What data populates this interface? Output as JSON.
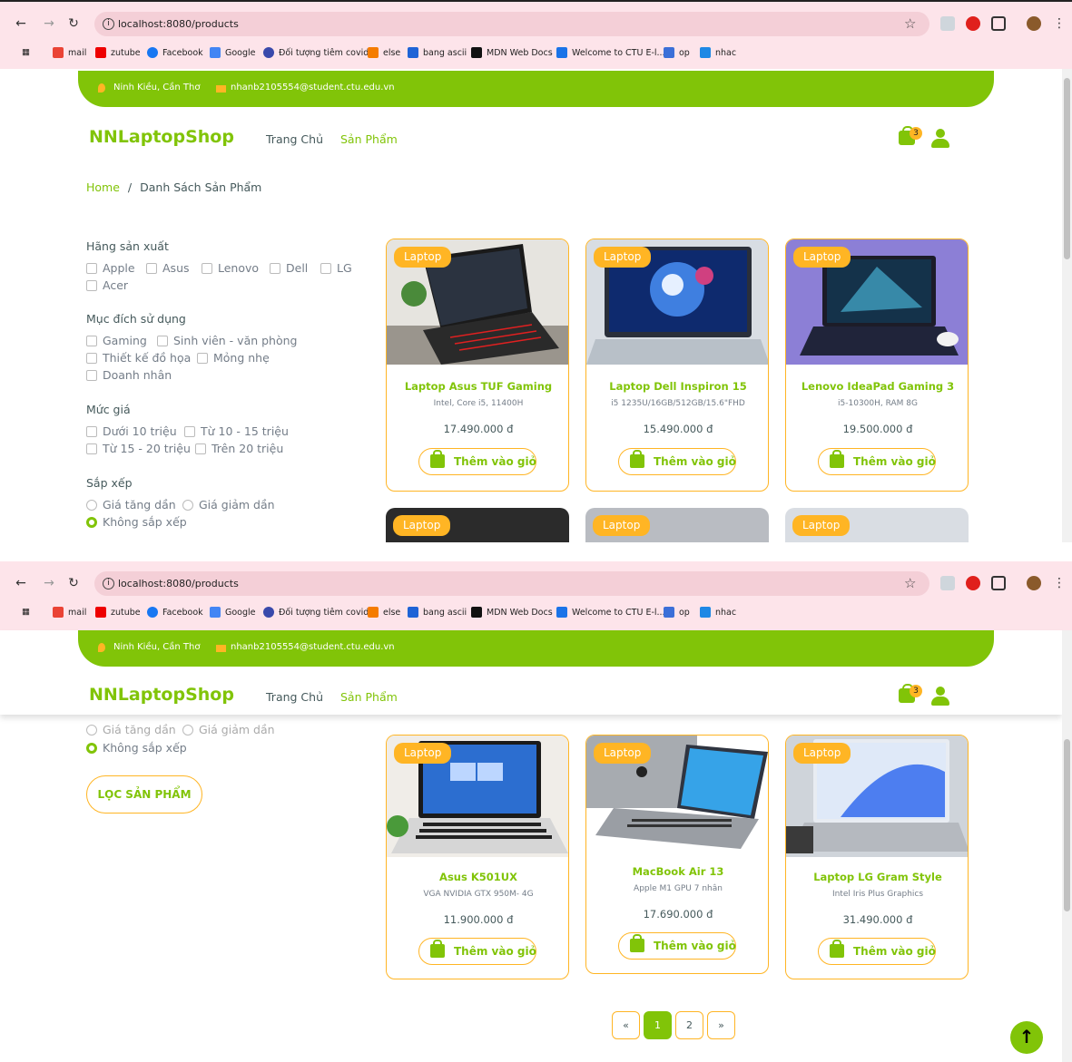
{
  "browser": {
    "url": "localhost:8080/products",
    "bookmarks": [
      "mail",
      "zutube",
      "Facebook",
      "Google",
      "Đối tượng tiêm covid",
      "else",
      "bang ascii",
      "MDN Web Docs",
      "Welcome to CTU E-l...",
      "op",
      "nhac"
    ]
  },
  "topbar": {
    "address": "Ninh Kiều, Cần Thơ",
    "email": "nhanb2105554@student.ctu.edu.vn"
  },
  "header": {
    "brand": "NNLaptopShop",
    "nav": [
      "Trang Chủ",
      "Sản Phẩm"
    ],
    "cart_count": "3"
  },
  "breadcrumb": {
    "home": "Home",
    "separator": "/",
    "current": "Danh Sách Sản Phẩm"
  },
  "filters": {
    "brand_title": "Hãng sản xuất",
    "brands": [
      "Apple",
      "Asus",
      "Lenovo",
      "Dell",
      "LG",
      "Acer"
    ],
    "purpose_title": "Mục đích sử dụng",
    "purposes": [
      "Gaming",
      "Sinh viên - văn phòng",
      "Thiết kế đồ họa",
      "Mỏng nhẹ",
      "Doanh nhân"
    ],
    "price_title": "Mức giá",
    "prices": [
      "Dưới 10 triệu",
      "Từ 10 - 15 triệu",
      "Từ 15 - 20 triệu",
      "Trên 20 triệu"
    ],
    "sort_title": "Sắp xếp",
    "sorts": [
      "Giá tăng dần",
      "Giá giảm dần",
      "Không sắp xếp"
    ],
    "selected_sort": "Không sắp xếp",
    "submit_label": "LỌC SẢN PHẨM"
  },
  "product_tag": "Laptop",
  "add_label": "Thêm vào giỏ",
  "products": [
    {
      "name": "Laptop Asus TUF Gaming",
      "desc": "Intel, Core i5, 11400H",
      "price": "17.490.000 đ"
    },
    {
      "name": "Laptop Dell Inspiron 15",
      "desc": "i5 1235U/16GB/512GB/15.6\"FHD",
      "price": "15.490.000 đ"
    },
    {
      "name": "Lenovo IdeaPad Gaming 3",
      "desc": "i5-10300H, RAM 8G",
      "price": "19.500.000 đ"
    },
    {
      "name": "Asus K501UX",
      "desc": "VGA NVIDIA GTX 950M- 4G",
      "price": "11.900.000 đ"
    },
    {
      "name": "MacBook Air 13",
      "desc": "Apple M1 GPU 7 nhân",
      "price": "17.690.000 đ"
    },
    {
      "name": "Laptop LG Gram Style",
      "desc": "Intel Iris Plus Graphics",
      "price": "31.490.000 đ"
    }
  ],
  "pagination": {
    "prev": "«",
    "pages": [
      "1",
      "2"
    ],
    "current": "1",
    "next": "»"
  },
  "colors": {
    "primary": "#81c408",
    "secondary": "#ffb524"
  }
}
